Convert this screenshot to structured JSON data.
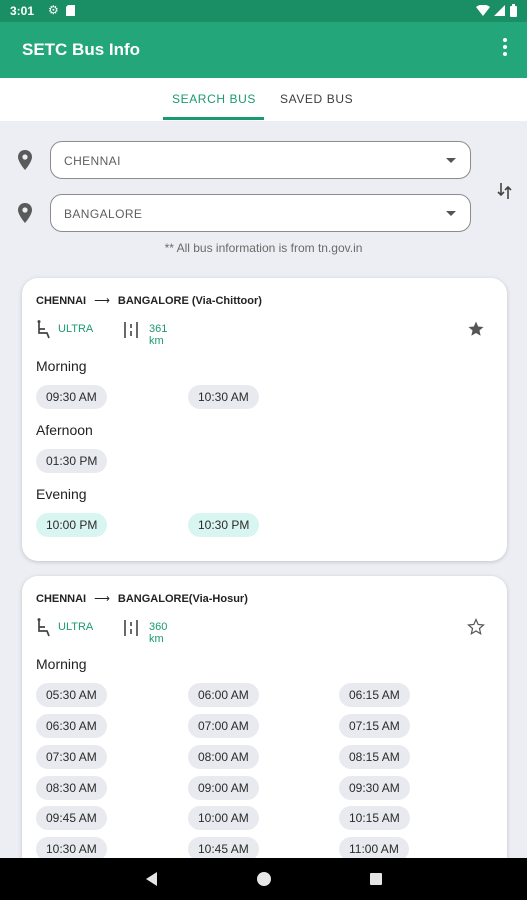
{
  "status_bar": {
    "time": "3:01",
    "icons": [
      "gear-icon",
      "sd-card-icon",
      "wifi-icon",
      "signal-icon",
      "battery-icon"
    ]
  },
  "app_bar": {
    "title": "SETC Bus Info",
    "menu_icon": "more-vert-icon"
  },
  "tabs": [
    {
      "label": "SEARCH BUS",
      "active": true
    },
    {
      "label": "SAVED BUS",
      "active": false
    }
  ],
  "search": {
    "from": "CHENNAI",
    "to": "BANGALORE",
    "swap_icon": "swap-vert-icon",
    "note": "** All bus information is from tn.gov.in"
  },
  "routes": [
    {
      "from": "CHENNAI",
      "to": "BANGALORE (Via-Chittoor)",
      "type": "ULTRA",
      "distance": "361 km",
      "saved": true,
      "sections": [
        {
          "name": "Morning",
          "times": [
            "09:30 AM",
            "10:30 AM"
          ]
        },
        {
          "name": "Afernoon",
          "times": [
            "01:30 PM"
          ]
        },
        {
          "name": "Evening",
          "times": [
            "10:00 PM",
            "10:30 PM"
          ]
        }
      ]
    },
    {
      "from": "CHENNAI",
      "to": "BANGALORE(Via-Hosur)",
      "type": "ULTRA",
      "distance": "360 km",
      "saved": false,
      "sections": [
        {
          "name": "Morning",
          "times": [
            "05:30 AM",
            "06:00 AM",
            "06:15 AM",
            "06:30 AM",
            "07:00 AM",
            "07:15 AM",
            "07:30 AM",
            "08:00 AM",
            "08:15 AM",
            "08:30 AM",
            "09:00 AM",
            "09:30 AM",
            "09:45 AM",
            "10:00 AM",
            "10:15 AM",
            "10:30 AM",
            "10:45 AM",
            "11:00 AM"
          ]
        }
      ]
    }
  ],
  "colors": {
    "primary": "#22a67a",
    "status_bar": "#1a8f65",
    "accent_text": "#1a9a70",
    "chip": "#e8eaf0",
    "chip_evening": "#d9f5f1",
    "background": "#eceef3"
  }
}
